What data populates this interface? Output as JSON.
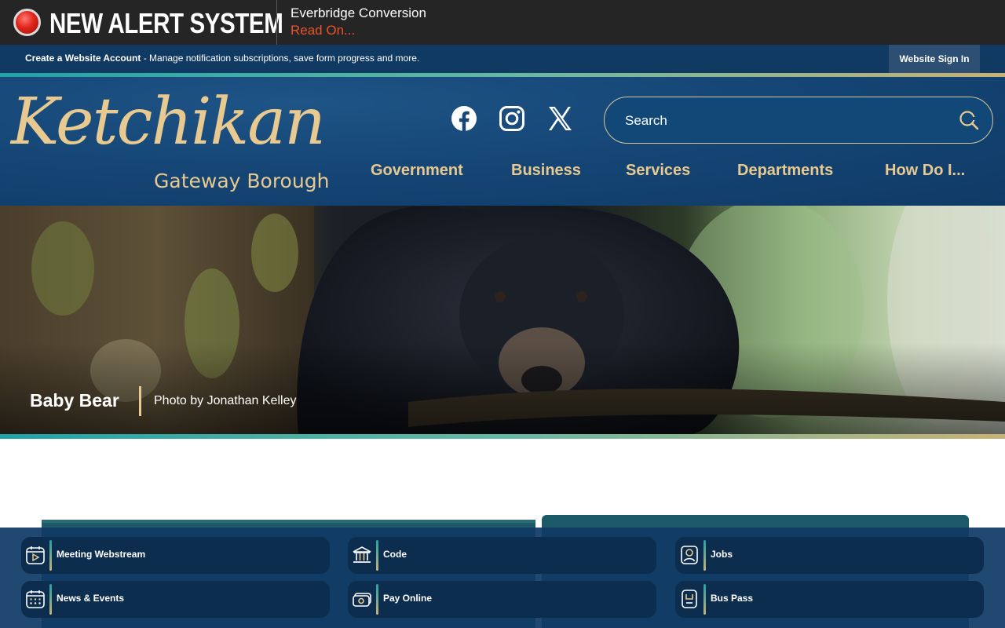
{
  "alert": {
    "title": "NEW ALERT SYSTEM",
    "message": "Everbridge Conversion",
    "link": "Read On..."
  },
  "account": {
    "create_label": "Create a Website Account",
    "description": " - Manage notification subscriptions, save form progress and more.",
    "signin_label": "Website Sign In"
  },
  "logo": {
    "script": "Ketchikan",
    "subtitle": "Gateway Borough"
  },
  "social": {
    "icons": [
      "facebook-icon",
      "instagram-icon",
      "x-icon"
    ]
  },
  "search": {
    "placeholder": "Search"
  },
  "nav": {
    "items": [
      "Government",
      "Business",
      "Services",
      "Departments",
      "How Do I..."
    ]
  },
  "hero": {
    "title": "Baby Bear",
    "credit": "Photo by Jonathan Kelley"
  },
  "quick_links": [
    {
      "label": "Meeting Webstream",
      "icon": "video-calendar-icon"
    },
    {
      "label": "Code",
      "icon": "building-columns-icon"
    },
    {
      "label": "Jobs",
      "icon": "person-badge-icon"
    },
    {
      "label": "News & Events",
      "icon": "calendar-icon"
    },
    {
      "label": "Pay Online",
      "icon": "cash-icon"
    },
    {
      "label": "Bus Pass",
      "icon": "pass-card-icon"
    }
  ],
  "colors": {
    "gold": "#e8c98f",
    "navy": "#113a63",
    "alert_red": "#e8542c",
    "teal": "#1fa3a6"
  }
}
